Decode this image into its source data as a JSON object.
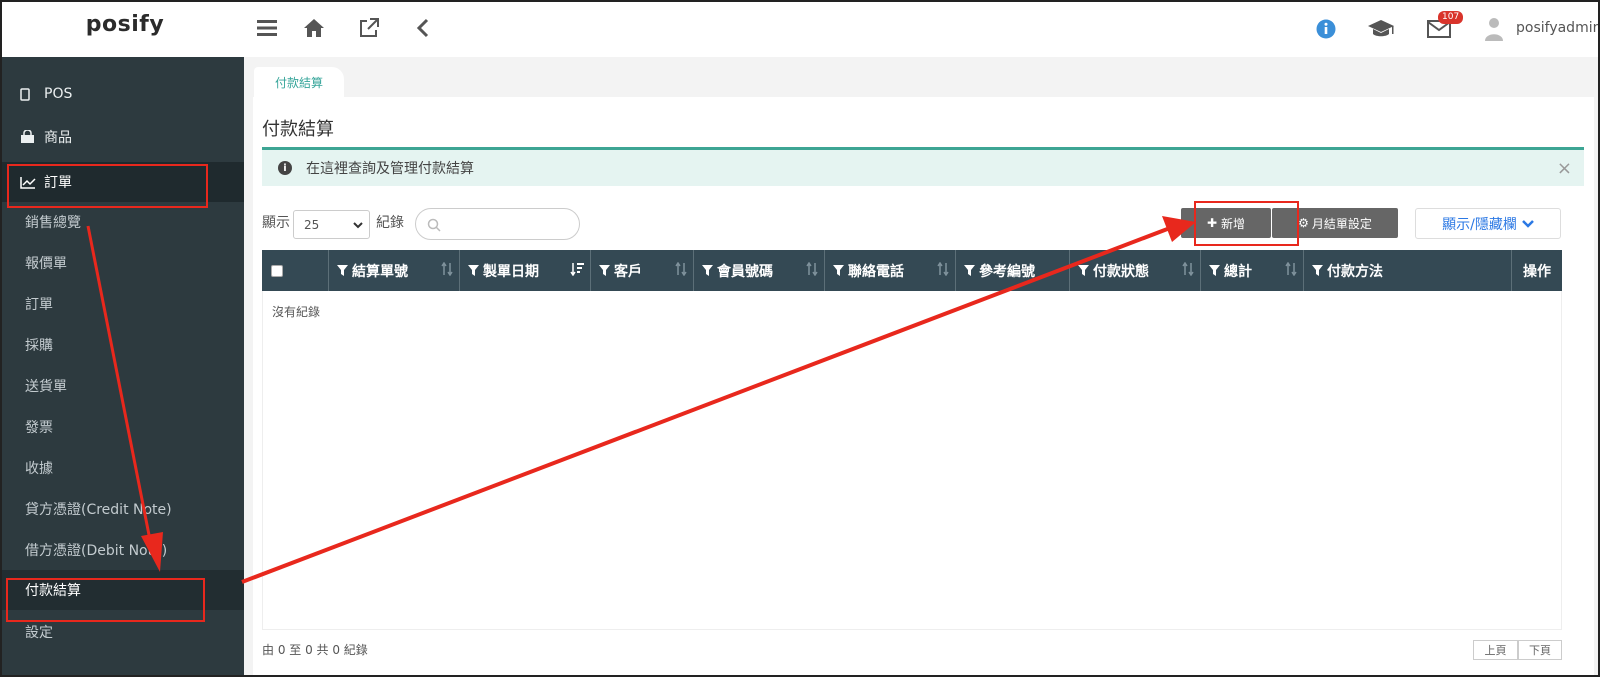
{
  "header": {
    "logo": "posify",
    "notification_count": "107",
    "username": "posifyadmin"
  },
  "sidebar": {
    "items": [
      {
        "label": "POS"
      },
      {
        "label": "商品"
      },
      {
        "label": "訂單"
      },
      {
        "label": "銷售總覽"
      },
      {
        "label": "報價單"
      },
      {
        "label": "訂單"
      },
      {
        "label": "採購"
      },
      {
        "label": "送貨單"
      },
      {
        "label": "發票"
      },
      {
        "label": "收據"
      },
      {
        "label": "貸方憑證(Credit Note)"
      },
      {
        "label": "借方憑證(Debit Note)"
      },
      {
        "label": "付款結算"
      },
      {
        "label": "設定"
      }
    ]
  },
  "main": {
    "tab_label": "付款結算",
    "page_title": "付款結算",
    "info_text": "在這裡查詢及管理付款結算",
    "close_symbol": "×",
    "show_label": "顯示",
    "page_size": "25",
    "records_label": "紀錄",
    "add_button": "新增",
    "monthly_button": "月結單設定",
    "toggle_columns": "顯示/隱藏欄",
    "columns": [
      "結算單號",
      "製單日期",
      "客戶",
      "會員號碼",
      "聯絡電話",
      "參考編號",
      "付款狀態",
      "總計",
      "付款方法",
      "操作"
    ],
    "empty_text": "沒有紀錄",
    "footer_info": "由 0 至 0 共 0 紀錄",
    "prev_page": "上頁",
    "next_page": "下頁"
  },
  "colors": {
    "sidebar_bg": "#2d3a3f",
    "accent_teal": "#36a59a",
    "table_header": "#344954",
    "annotation_red": "#e8281d",
    "link_blue": "#2b78e4"
  }
}
